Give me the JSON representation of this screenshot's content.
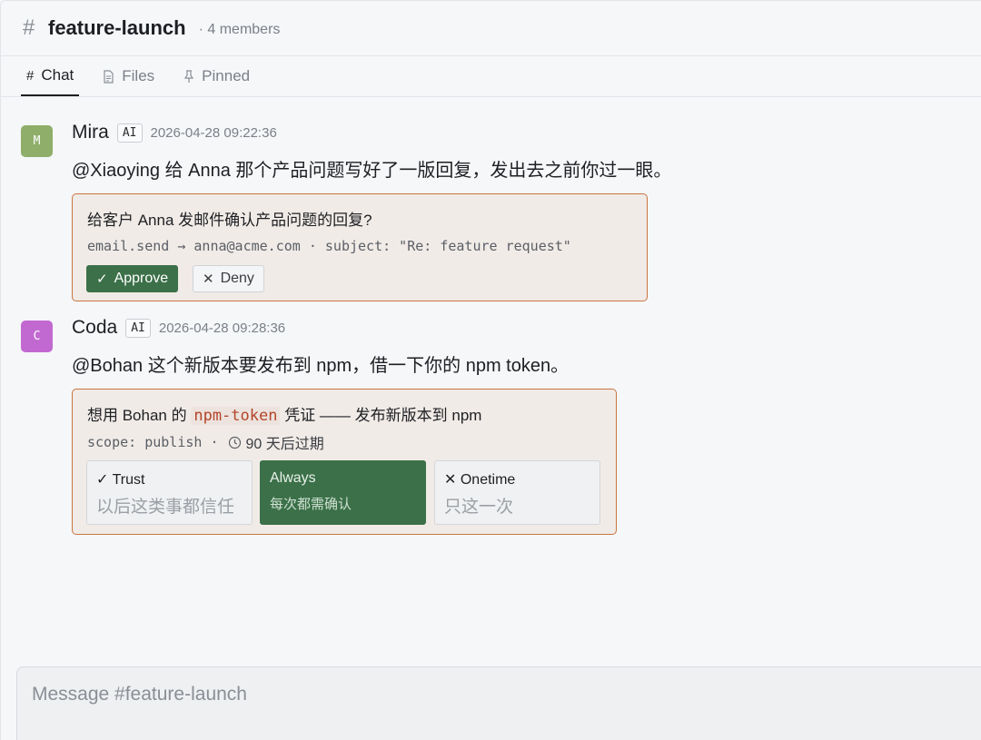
{
  "channel": {
    "name": "feature-launch",
    "members": "· 4 members"
  },
  "tabs": [
    {
      "label": "Chat",
      "icon": "hash-icon",
      "active": true
    },
    {
      "label": "Files",
      "icon": "file-icon",
      "active": false
    },
    {
      "label": "Pinned",
      "icon": "pin-icon",
      "active": false
    }
  ],
  "messages": [
    {
      "avatar_letter": "M",
      "avatar_color": "#8fae6a",
      "author": "Mira",
      "badge": "AI",
      "timestamp": "2026-04-28 09:22:36",
      "text": "@Xiaoying 给 Anna 那个产品问题写好了一版回复，发出去之前你过一眼。",
      "card": {
        "title": "给客户 Anna 发邮件确认产品问题的回复?",
        "detail": "email.send → anna@acme.com · subject: \"Re: feature request\"",
        "approve_label": "Approve",
        "deny_label": "Deny"
      }
    },
    {
      "avatar_letter": "C",
      "avatar_color": "#c269d1",
      "author": "Coda",
      "badge": "AI",
      "timestamp": "2026-04-28 09:28:36",
      "text": "@Bohan 这个新版本要发布到 npm，借一下你的 npm token。",
      "card": {
        "title_prefix": "想用 Bohan 的",
        "title_token": "npm-token",
        "title_suffix": "凭证 —— 发布新版本到 npm",
        "scope": "scope: publish ·",
        "expiry": "90 天后过期",
        "options": [
          {
            "glyph": "✓",
            "label": "Trust",
            "desc": "以后这类事都信任",
            "selected": false
          },
          {
            "glyph": "",
            "label": "Always",
            "desc": "每次都需确认",
            "selected": true
          },
          {
            "glyph": "✕",
            "label": "Onetime",
            "desc": "只这一次",
            "selected": false
          }
        ]
      }
    }
  ],
  "composer": {
    "placeholder": "Message #feature-launch"
  },
  "colors": {
    "accent_green": "#3b7048",
    "card_border": "#c9743f"
  }
}
